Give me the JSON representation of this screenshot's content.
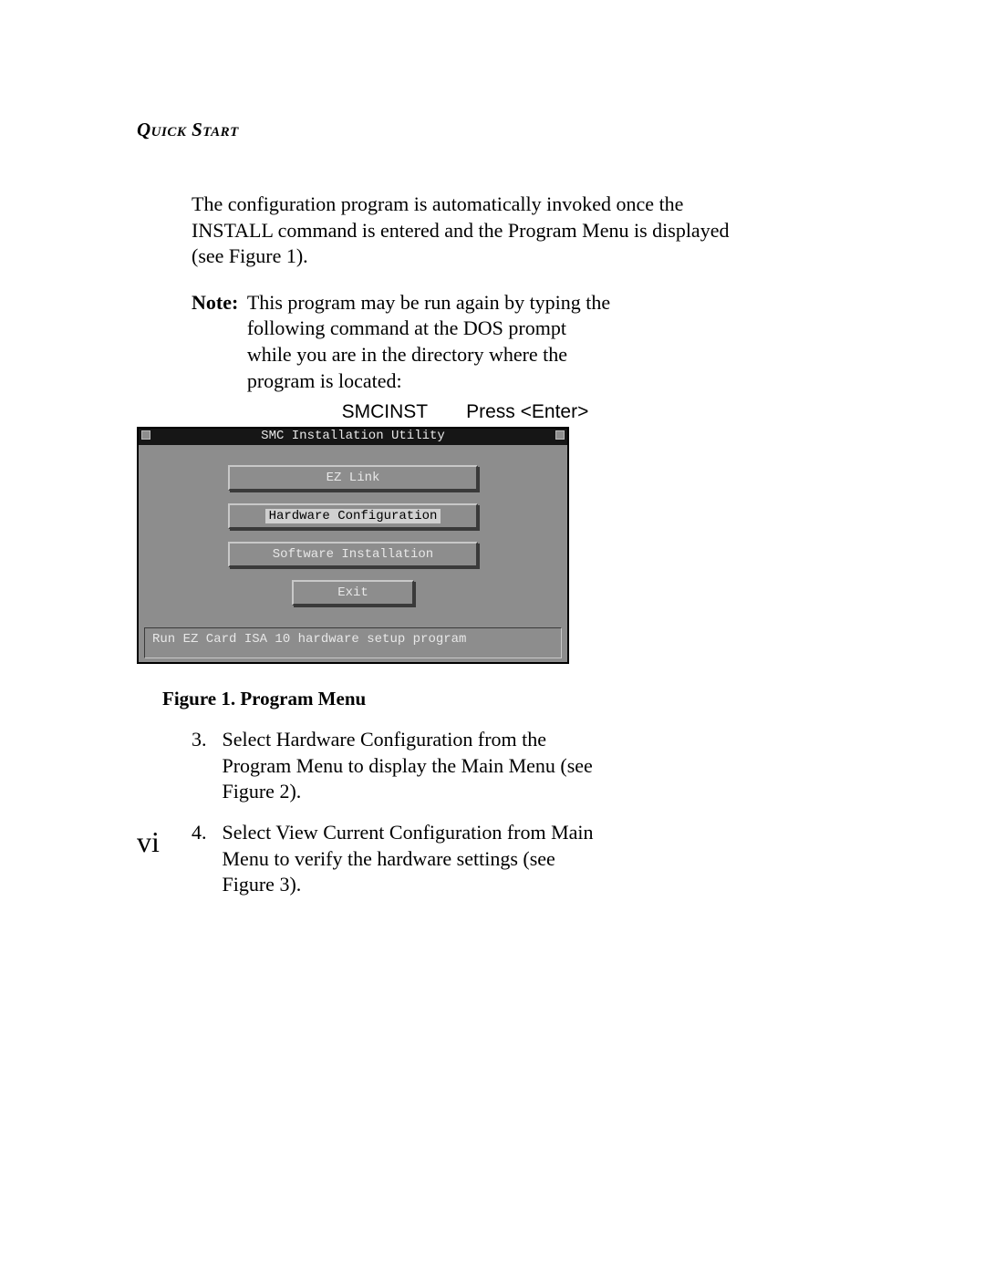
{
  "header": "Quick Start",
  "para1": "The configuration program is automatically invoked once the INSTALL command is entered and the Program Menu is displayed (see Figure 1).",
  "note": {
    "label": "Note:",
    "text": "This program may be run again by typing the following command at the DOS prompt while you are in the directory where the program is located:"
  },
  "command_line": "SMCINST  Press <Enter>",
  "dos": {
    "title": "SMC Installation Utility",
    "buttons": {
      "ez_link": "EZ  Link",
      "hw_config": "Hardware  Configuration",
      "sw_install": "Software Installation",
      "exit": "Exit"
    },
    "status": "Run EZ Card ISA 10 hardware setup program"
  },
  "figure_caption": "Figure 1.  Program Menu",
  "list": {
    "item3": {
      "num": "3.",
      "text": "Select Hardware Configuration from the Program Menu to display the Main Menu (see Figure 2)."
    },
    "item4": {
      "num": "4.",
      "text": "Select View Current Configuration from Main Menu to verify the hardware settings (see Figure 3)."
    }
  },
  "page_number": "vi"
}
